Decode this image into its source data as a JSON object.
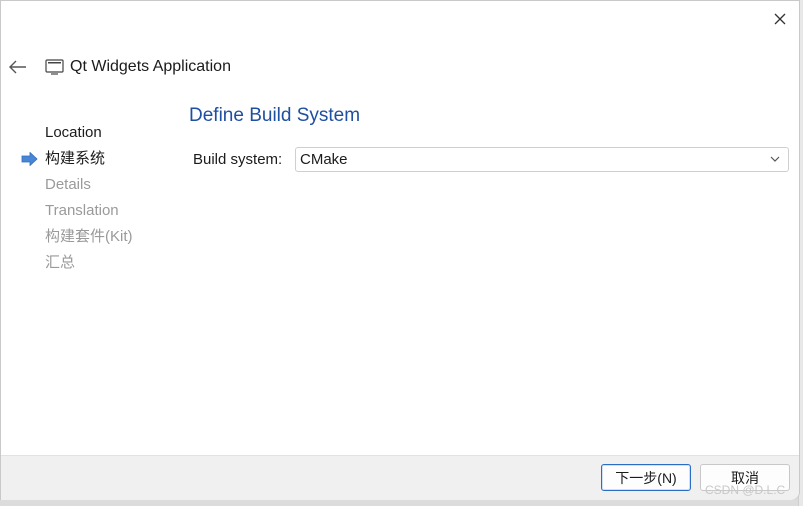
{
  "window": {
    "close_icon": "close-icon",
    "back_icon": "back-arrow-icon",
    "title_icon": "application-window-icon",
    "title": "Qt Widgets Application"
  },
  "steps": [
    {
      "label": "Location",
      "state": "done"
    },
    {
      "label": "构建系统",
      "state": "current"
    },
    {
      "label": "Details",
      "state": "pending"
    },
    {
      "label": "Translation",
      "state": "pending"
    },
    {
      "label": "构建套件(Kit)",
      "state": "pending"
    },
    {
      "label": "汇总",
      "state": "pending"
    }
  ],
  "page": {
    "title": "Define Build System",
    "build_system_label": "Build system:",
    "build_system_value": "CMake"
  },
  "buttons": {
    "next": "下一步(N)",
    "cancel": "取消"
  },
  "watermark": "CSDN @D.L.C",
  "colors": {
    "accent": "#1f4fa0",
    "current_arrow": "#4a86d6",
    "pending_text": "#9a9a9a"
  }
}
